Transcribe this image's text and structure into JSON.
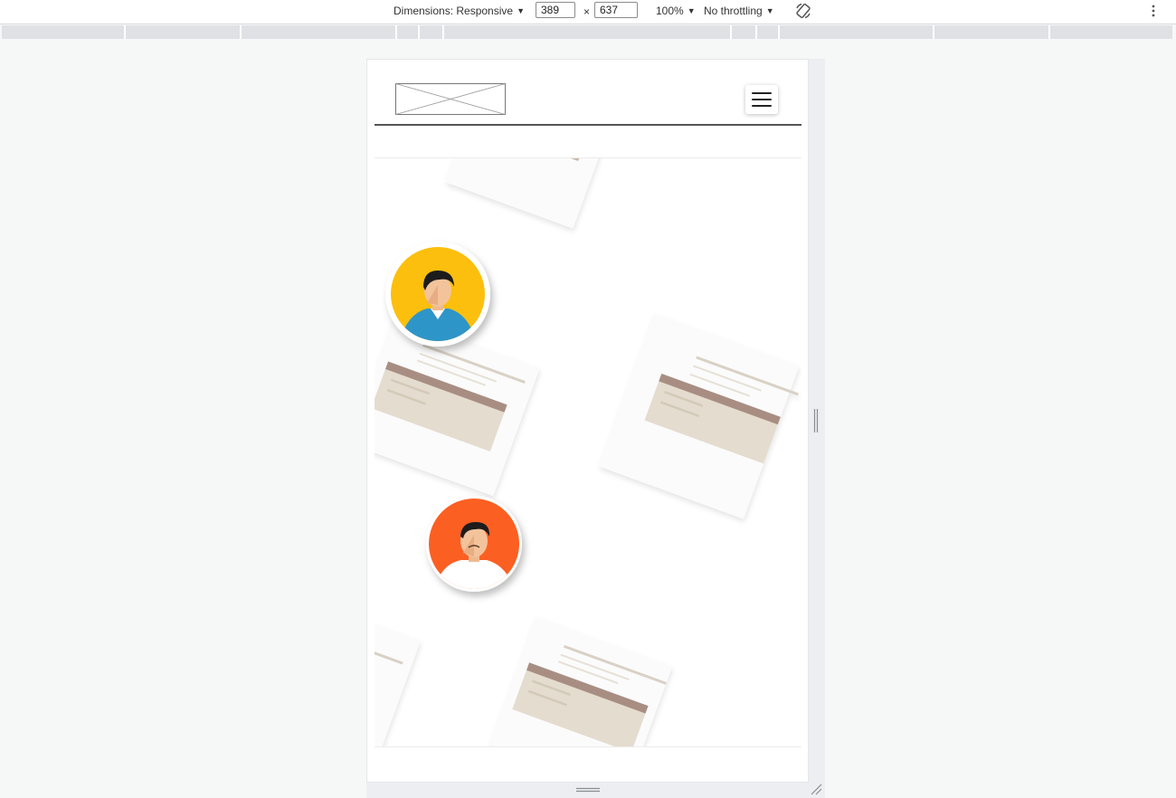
{
  "devtools": {
    "dimensions_label": "Dimensions: Responsive",
    "width_value": "389",
    "height_value": "637",
    "times_sign": "×",
    "zoom_label": "100%",
    "throttling_label": "No throttling",
    "icons": [
      "chevron-down-icon",
      "rotate-icon",
      "more-vertical-icon"
    ]
  },
  "site": {
    "logo_alt": "logo placeholder",
    "menu_icon": "hamburger-menu-icon",
    "hero": {
      "avatars": [
        {
          "name": "avatar-man-yellow",
          "color": "#fcbf0e"
        },
        {
          "name": "avatar-man-orange",
          "color": "#fc5f23"
        }
      ],
      "card_colors": {
        "card_bg": "#fbfbfb",
        "card_band": "#e4dccf",
        "card_band_top": "#a88e82",
        "card_lines": "#d9d1c4"
      }
    }
  }
}
